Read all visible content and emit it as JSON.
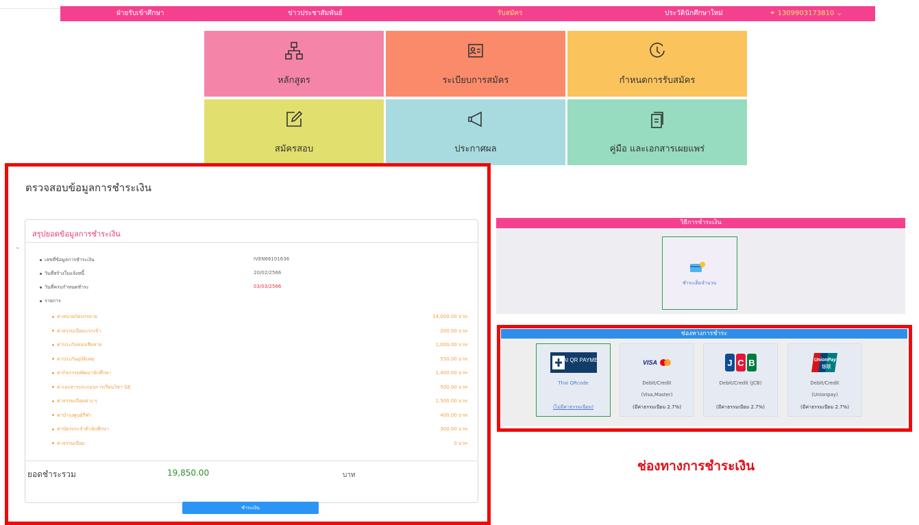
{
  "nav": {
    "items": [
      "ฝ่ายรับเข้าศึกษา",
      "ข่าวประชาสัมพันธ์",
      "รับสมัคร",
      "ประวัตินักศึกษาใหม่"
    ],
    "user": "1309903173810",
    "active_index": 2
  },
  "tiles": [
    {
      "label": "หลักสูตร",
      "icon": "hierarchy-icon"
    },
    {
      "label": "ระเบียบการสมัคร",
      "icon": "id-card-icon"
    },
    {
      "label": "กำหนดการรับสมัคร",
      "icon": "clock-icon"
    },
    {
      "label": "สมัครสอบ",
      "icon": "edit-icon"
    },
    {
      "label": "ประกาศผล",
      "icon": "megaphone-icon"
    },
    {
      "label": "คู่มือ และเอกสารเผยแพร่",
      "icon": "document-icon"
    }
  ],
  "payment": {
    "page_title": "ตรวจสอบข้อมูลการชำระเงิน",
    "summary_title": "สรุปยอดข้อมูลการชำระเงิน",
    "fields": [
      {
        "label": "เลขที่ข้อมูลการชำระเงิน",
        "value": "IVEN66101636"
      },
      {
        "label": "วันที่สร้างใบแจ้งหนี้",
        "value": "20/02/2566"
      },
      {
        "label": "วันที่ครบกำหนดชำระ",
        "value": "03/03/2566"
      }
    ],
    "items_label": "รายการ",
    "items": [
      {
        "name": "ค่าหน่วยกิตบรรยาย",
        "amount": "14,000.00 บาท"
      },
      {
        "name": "ค่าธรรมเนียมแรกเข้า",
        "amount": "200.00 บาท"
      },
      {
        "name": "ค่าประกันของเสียหาย",
        "amount": "1,000.00 บาท"
      },
      {
        "name": "ค่าประกันอุบัติเหตุ",
        "amount": "550.00 บาท"
      },
      {
        "name": "ค่ากิจกรรมพัฒนานักศึกษา",
        "amount": "1,400.00 บาท"
      },
      {
        "name": "ค่าเอกสารประกอบการเรียนวิชา GE",
        "amount": "500.00 บาท"
      },
      {
        "name": "ค่าธรรมเนียมต่าง ๆ",
        "amount": "1,500.00 บาท"
      },
      {
        "name": "ค่าบำรุงศูนย์กีฬา",
        "amount": "400.00 บาท"
      },
      {
        "name": "ค่าบัตรประจำตัวนักศึกษา",
        "amount": "300.00 บาท"
      },
      {
        "name": "ค่าธรรมเนียม",
        "amount": "0 บาท"
      }
    ],
    "total_label": "ยอดชำระรวม",
    "total_value": "19,850.00",
    "total_unit": "บาท",
    "pay_button": "ชำระเงิน"
  },
  "method": {
    "title": "วิธีการชำระเงิน",
    "card_label": "ชำระเต็มจำนวน"
  },
  "channel": {
    "title": "ช่องทางการชำระ",
    "options": [
      {
        "logo": "THAI QR PAYMENT",
        "line1": "Thai QRcode",
        "line2": "",
        "line3": "(ไม่มีค่าธรรมเนียม)"
      },
      {
        "logo": "VISA",
        "line1": "Debit/Credit",
        "line2": "(Visa,Master)",
        "line3": "(มีค่าธรรมเนียม 2.7%)"
      },
      {
        "logo": "JCB",
        "line1": "Debit/Credit (JCB)",
        "line2": "",
        "line3": "(มีค่าธรรมเนียม 2.7%)"
      },
      {
        "logo": "UnionPay",
        "line1": "Debit/Credit",
        "line2": "(Unionpay)",
        "line3": "(มีค่าธรรมเนียม 2.7%)"
      }
    ]
  },
  "caption": "ช่องทางการชำระเงิน",
  "colors": {
    "nav": "#f5408f",
    "highlight": "#ee0a0a",
    "accent_blue": "#2b95f5"
  }
}
